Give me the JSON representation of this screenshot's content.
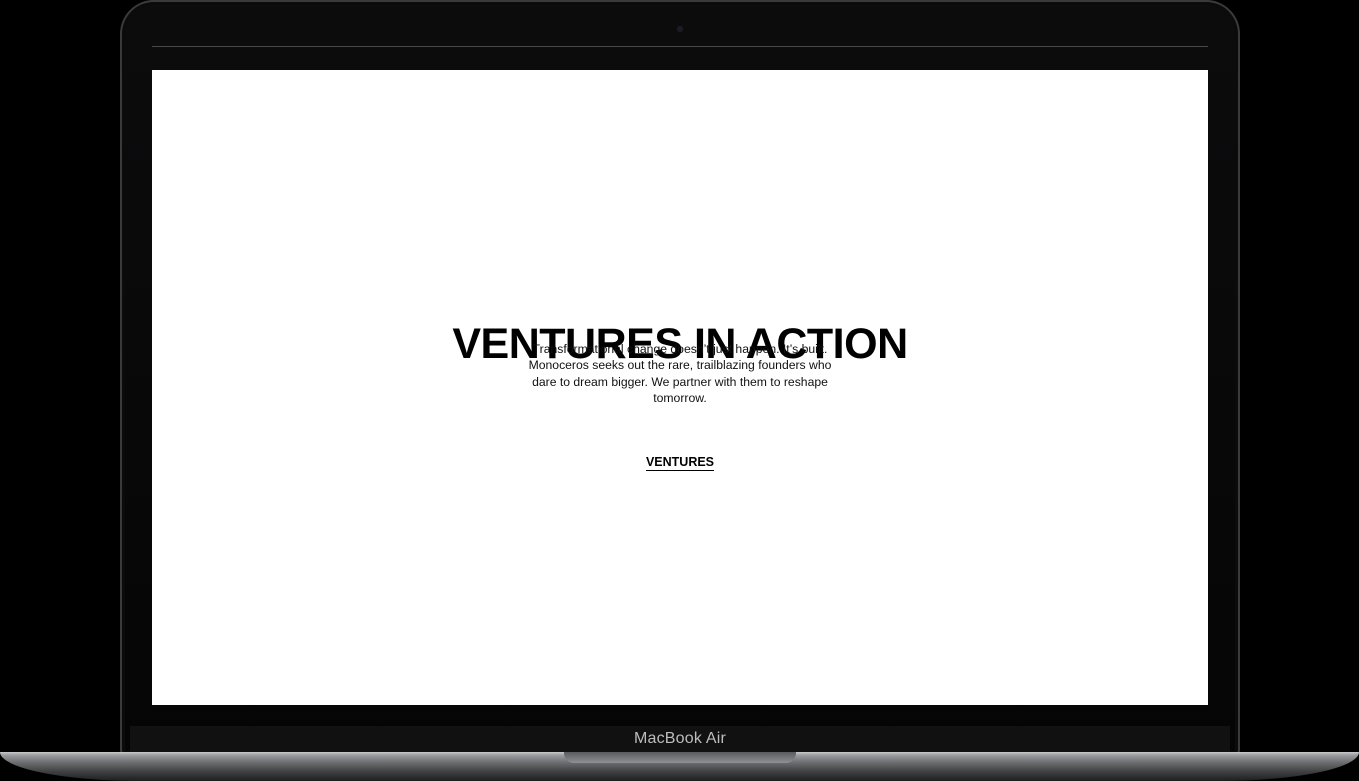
{
  "device": {
    "model_label": "MacBook Air"
  },
  "hero": {
    "title": "VENTURES IN ACTION",
    "description": "Transformational change doesn’t just happen. It’s built. Monoceros seeks out the rare, trailblazing founders who dare to dream bigger. We partner with them to reshape tomorrow.",
    "link_label": "VENTURES"
  },
  "colors": {
    "page_background": "#ffffff",
    "text": "#000000",
    "device_frame": "#000000"
  }
}
